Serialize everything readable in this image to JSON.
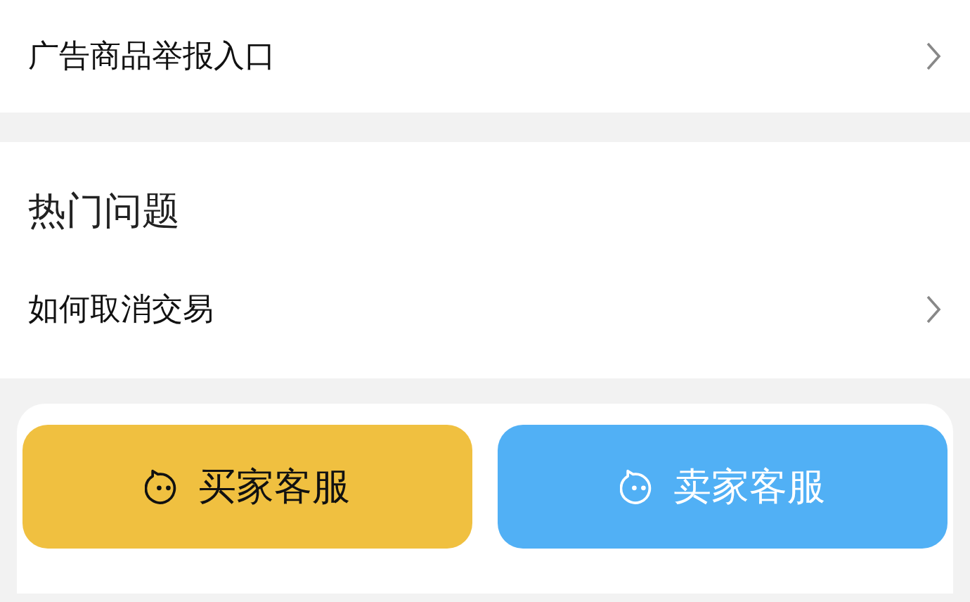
{
  "top_link": {
    "label": "广告商品举报入口"
  },
  "faq": {
    "title": "热门问题",
    "items": [
      {
        "label": "如何取消交易"
      }
    ]
  },
  "buttons": [
    {
      "label": "买家客服",
      "kind": "buyer"
    },
    {
      "label": "卖家客服",
      "kind": "seller"
    }
  ]
}
